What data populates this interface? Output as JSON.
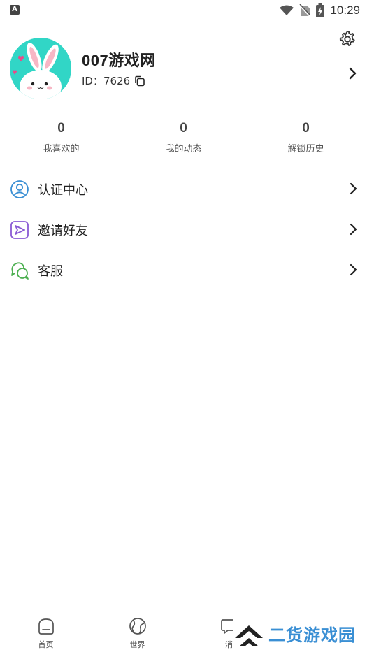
{
  "status_bar": {
    "left_icon": "A",
    "time": "10:29",
    "icons": [
      "wifi-icon",
      "no-sim-icon",
      "battery-charging-icon"
    ]
  },
  "profile": {
    "name": "007游戏网",
    "id_label": "ID：",
    "id_value": "7626"
  },
  "stats": [
    {
      "value": "0",
      "label": "我喜欢的"
    },
    {
      "value": "0",
      "label": "我的动态"
    },
    {
      "value": "0",
      "label": "解锁历史"
    }
  ],
  "menu": [
    {
      "label": "认证中心",
      "icon": "user-verify-icon",
      "color": "#3a8fd4"
    },
    {
      "label": "邀请好友",
      "icon": "send-icon",
      "color": "#8a5ad4"
    },
    {
      "label": "客服",
      "icon": "chat-bubbles-icon",
      "color": "#4caf50"
    }
  ],
  "bottom_nav": [
    {
      "label": "首页",
      "icon": "home-icon"
    },
    {
      "label": "世界",
      "icon": "globe-icon"
    },
    {
      "label": "消",
      "icon": "message-icon"
    },
    {
      "label": "",
      "icon": "profile-icon"
    }
  ],
  "watermark": {
    "text": "二货游戏园"
  },
  "colors": {
    "avatar_bg": "#31d6c6",
    "accent_blue": "#3a8fd4",
    "accent_purple": "#8a5ad4",
    "accent_green": "#4caf50"
  }
}
